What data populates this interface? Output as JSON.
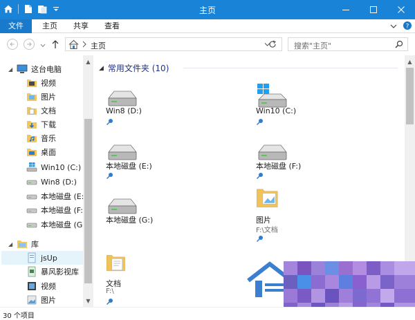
{
  "window": {
    "title": "主页"
  },
  "ribbon": {
    "tabs": [
      {
        "label": "文件"
      },
      {
        "label": "主页"
      },
      {
        "label": "共享"
      },
      {
        "label": "查看"
      }
    ]
  },
  "address": {
    "location": "主页"
  },
  "search": {
    "placeholder": "搜索\"主页\""
  },
  "nav": {
    "items": [
      {
        "label": "这台电脑",
        "icon": "computer-icon"
      },
      {
        "label": "视频",
        "icon": "video-folder-icon"
      },
      {
        "label": "图片",
        "icon": "pictures-folder-icon"
      },
      {
        "label": "文档",
        "icon": "documents-folder-icon"
      },
      {
        "label": "下载",
        "icon": "downloads-folder-icon"
      },
      {
        "label": "音乐",
        "icon": "music-folder-icon"
      },
      {
        "label": "桌面",
        "icon": "desktop-folder-icon"
      },
      {
        "label": "Win10 (C:)",
        "icon": "windows-drive-icon"
      },
      {
        "label": "Win8 (D:)",
        "icon": "drive-icon"
      },
      {
        "label": "本地磁盘 (E:)",
        "icon": "drive-icon"
      },
      {
        "label": "本地磁盘 (F:)",
        "icon": "drive-icon"
      },
      {
        "label": "本地磁盘 (G:)",
        "icon": "drive-icon"
      },
      {
        "label": "库",
        "icon": "libraries-icon"
      },
      {
        "label": "jsUp",
        "icon": "library-icon"
      },
      {
        "label": "暴风影视库",
        "icon": "library-icon"
      },
      {
        "label": "视频",
        "icon": "video-library-icon"
      },
      {
        "label": "图片",
        "icon": "pictures-library-icon"
      }
    ]
  },
  "content": {
    "group_title": "常用文件夹 (10)",
    "items": [
      {
        "name": "Win8 (D:)",
        "sub": "",
        "icon": "drive-icon"
      },
      {
        "name": "Win10 (C:)",
        "sub": "",
        "icon": "windows-drive-icon"
      },
      {
        "name": "本地磁盘 (E:)",
        "sub": "",
        "icon": "drive-icon"
      },
      {
        "name": "本地磁盘 (F:)",
        "sub": "",
        "icon": "drive-icon"
      },
      {
        "name": "本地磁盘 (G:)",
        "sub": "",
        "icon": "drive-icon"
      },
      {
        "name": "图片",
        "sub": "F:\\文档",
        "icon": "pictures-folder-icon"
      },
      {
        "name": "文档",
        "sub": "F:\\",
        "icon": "documents-folder-icon"
      }
    ]
  },
  "status": {
    "count": "30 个项目"
  },
  "colors": {
    "titlebar": "#1883d7",
    "file_tab": "#1979ca",
    "group_header": "#1e3287",
    "selection": "#e5f3fb"
  }
}
